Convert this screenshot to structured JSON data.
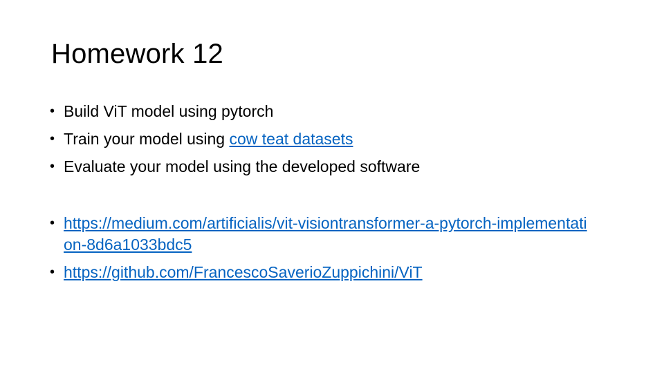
{
  "slide": {
    "title": "Homework 12",
    "bullets": [
      {
        "prefix": "Build ViT model using pytorch",
        "link": ""
      },
      {
        "prefix": "Train your model using ",
        "link": "cow teat datasets"
      },
      {
        "prefix": "Evaluate your model using the developed software",
        "link": ""
      }
    ],
    "links": [
      {
        "text": "https://medium.com/artificialis/vit-visiontransformer-a-pytorch-implementation-8d6a1033bdc5"
      },
      {
        "text": "https://github.com/FrancescoSaverioZuppichini/ViT"
      }
    ],
    "bullet_glyph": "•",
    "link_color": "#0563c1"
  }
}
